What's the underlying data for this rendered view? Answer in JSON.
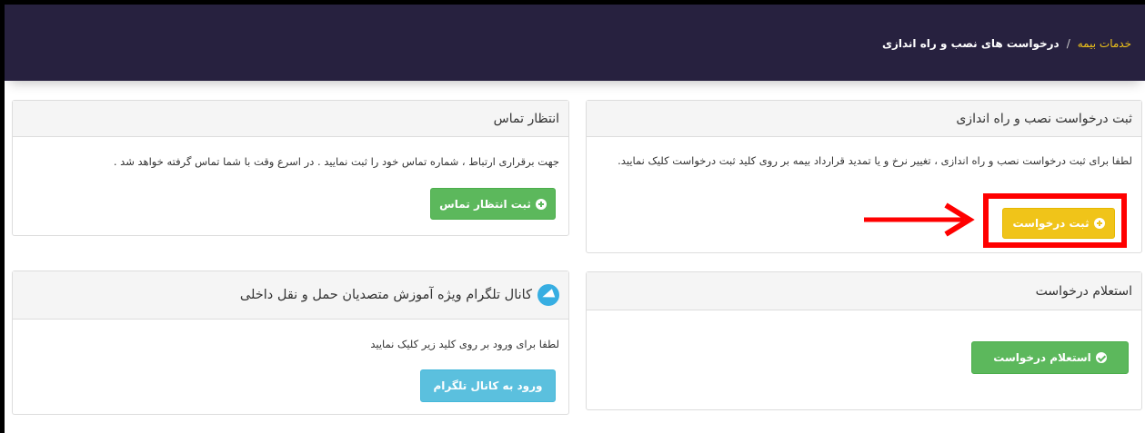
{
  "breadcrumb": {
    "home": "خدمات بیمه",
    "separator": "/",
    "current": "درخواست های نصب و راه اندازی"
  },
  "register_panel": {
    "title": "ثبت درخواست نصب و راه اندازی",
    "body": "لطفا برای ثبت درخواست نصب و راه اندازی ، تغییر نرخ و یا تمدید قرارداد بیمه بر روی کلید ثبت درخواست کلیک نمایید.",
    "button": "ثبت درخواست"
  },
  "callback_panel": {
    "title": "انتظار تماس",
    "body": "جهت برقراری ارتباط ، شماره تماس خود را ثبت نمایید . در اسرع وقت با شما تماس گرفته خواهد شد .",
    "button": "ثبت انتظار تماس"
  },
  "inquiry_panel": {
    "title": "استعلام درخواست",
    "button": "استعلام درخواست"
  },
  "telegram_panel": {
    "title": "کانال تلگرام ویژه آموزش متصدیان حمل و نقل داخلی",
    "body": "لطفا برای ورود بر روی کلید زیر کلیک نمایید",
    "button": "ورود به کانال تلگرام"
  },
  "colors": {
    "header_bg": "#27213f",
    "accent_yellow": "#f0c419",
    "success_green": "#5cb85c",
    "info_blue": "#5bc0de",
    "annotation_red": "#ff0000"
  }
}
